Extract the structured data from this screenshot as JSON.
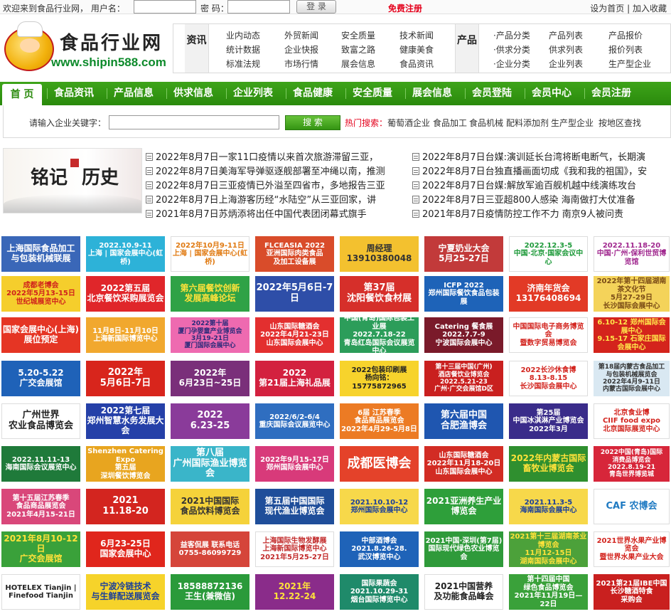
{
  "topbar": {
    "welcome": "欢迎来到食品行业网， 用户名：",
    "password_label": "密 码：",
    "login_button": "登 录",
    "register": "免费注册",
    "set_home": "设为首页",
    "divider": "|",
    "add_favorite": "加入收藏"
  },
  "logo": {
    "name": "食品行业网",
    "url": "www.shipin588.com"
  },
  "nav": {
    "cat1": "资讯",
    "cat2": "产品",
    "links1": [
      "业内动态",
      "外贸新闻",
      "安全质量",
      "技术新闻",
      "统计数据",
      "企业快报",
      "致富之路",
      "健康美食",
      "标准法规",
      "市场行情",
      "展会信息",
      "食品资讯"
    ],
    "links2": [
      "·产品分类",
      "产品列表",
      "产品报价",
      "·供求分类",
      "供求列表",
      "报价列表",
      "·企业分类",
      "企业列表",
      "生产型企业"
    ]
  },
  "menu": [
    "首 页",
    "食品资讯",
    "产品信息",
    "供求信息",
    "企业列表",
    "食品健康",
    "安全质量",
    "展会信息",
    "会员登陆",
    "会员中心",
    "会员注册"
  ],
  "search": {
    "label": "请输入企业关键字：",
    "button": "搜 索",
    "hot_label": "热门搜索：",
    "hot": [
      "葡萄酒企业",
      "食品加工",
      "食品机械",
      "配料添加剂",
      "生产型企业",
      "按地区查找"
    ]
  },
  "history": {
    "t1": "铭记",
    "t2": "历史"
  },
  "news_left": [
    "2022年8月7日一家11口疫情以来首次旅游滞留三亚，",
    "2022年8月7日美海军导弹驱逐舰部署至冲绳以南，推测",
    "2022年8月7日三亚疫情已外溢至四省市，多地报告三亚",
    "2022年8月7日上海游客历经“水陆空”从三亚回家，讲",
    "2021年8月7日苏炳添将出任中国代表团闭幕式旗手"
  ],
  "news_right": [
    "2022年8月7日台媒:演训延长台湾将断电断气，长期演",
    "2022年8月7日台独直播画面切成《我和我的祖国》，安",
    "2022年8月7日台媒:解放军逾百舰机越中线演练攻台",
    "2022年8月7日三亚超800人感染 海南做打大仗准备",
    "2021年8月7日疫情防控工作不力 南京9人被问责"
  ],
  "ads": [
    [
      {
        "text": "上海国际食品加工\n与包装机械联展",
        "bg": "#3a67b8",
        "fg": "#ffffff"
      },
      {
        "text": "2022.10.9-11\n上海 | 国家会展中心(虹桥)",
        "bg": "#2db2d8",
        "fg": "#ffffff"
      },
      {
        "text": "2022年10月9-11日\n上海 | 国家会展中心(虹桥)",
        "bg": "#ffffff",
        "fg": "#e07a12"
      },
      {
        "text": "FLCEASIA 2022\n亚洲国际肉类食品\n及加工设备展",
        "bg": "#d94c2a",
        "fg": "#ffffff"
      },
      {
        "text": "周经理\n13910380048",
        "bg": "#f3c12f",
        "fg": "#333333"
      },
      {
        "text": "宁夏奶业大会\n5月25-27日",
        "bg": "#c23a3a",
        "fg": "#ffffff"
      },
      {
        "text": "2022.12.3-5\n中国·北京·国家会议中心",
        "bg": "#ffffff",
        "fg": "#1e9a3a"
      },
      {
        "text": "2022.11.18-20\n中国·广州·保利世贸博览馆",
        "bg": "#ffffff",
        "fg": "#a0278e"
      }
    ],
    [
      {
        "text": "成都老博会\n2022年5月13-15日 世纪城展览中心",
        "bg": "#f5ce2c",
        "fg": "#d0221c"
      },
      {
        "text": "2022第五届\n北京餐饮采购展览会",
        "bg": "#e0262a",
        "fg": "#ffffff"
      },
      {
        "text": "第六届餐饮创新\n发展高峰论坛",
        "bg": "#2fa246",
        "fg": "#ffe23a"
      },
      {
        "text": "2022年5月6日-7日",
        "bg": "#2e4ea8",
        "fg": "#ffffff"
      },
      {
        "text": "第37届\n沈阳餐饮食材展",
        "bg": "#d62f2a",
        "fg": "#ffffff"
      },
      {
        "text": "ICFP 2022\n郑州国际餐饮食品包装展",
        "bg": "#1e63b8",
        "fg": "#ffffff"
      },
      {
        "text": "济南年货会\n13176408694",
        "bg": "#e23a26",
        "fg": "#ffffff"
      },
      {
        "text": "2022年第十四届湖南茶文化节\n5月27-29日\n长沙国际会展中心",
        "bg": "#f4d35a",
        "fg": "#7a4b16"
      }
    ],
    [
      {
        "text": "国家会展中心(上海)\n展位预定",
        "bg": "#e53524",
        "fg": "#ffffff"
      },
      {
        "text": "11月8日-11月10日\n上海新国际博览中心",
        "bg": "#f1a82e",
        "fg": "#ffffff"
      },
      {
        "text": "2022第十届\n厦门孕婴童产业博览会\n3月19-21日\n厦门国际会展中心",
        "bg": "#ee6ab0",
        "fg": "#2a2a7a"
      },
      {
        "text": "山东国际糖酒会\n2022年4月21-23日\n山东国际会展中心",
        "bg": "#e32f2f",
        "fg": "#ffffff"
      },
      {
        "text": "中国(青岛)国际包装工业展\n2022.7.18-22\n青岛红岛国际会议展览中心",
        "bg": "#2c9d5a",
        "fg": "#ffffff"
      },
      {
        "text": "Catering 餐食展\n2022.7.7-9\n宁波国际会展中心",
        "bg": "#7a1a2a",
        "fg": "#ffffff"
      },
      {
        "text": "中国国际电子商务博览会\n暨数字贸易博览会",
        "bg": "#ffffff",
        "fg": "#d3251f"
      },
      {
        "text": "6.10-12 郑州国际会展中心\n9.15-17 石家庄国际会展中心",
        "bg": "#d4241c",
        "fg": "#ffe54a"
      }
    ],
    [
      {
        "text": "5.20-5.22\n广交会展馆",
        "bg": "#1f62b8",
        "fg": "#ffffff"
      },
      {
        "text": "2022年\n5月6日-7日",
        "bg": "#d8251c",
        "fg": "#ffffff"
      },
      {
        "text": "2022年\n6月23日~25日",
        "bg": "#7a2f7a",
        "fg": "#ffffff"
      },
      {
        "text": "2022\n第21届上海礼品展",
        "bg": "#d3213f",
        "fg": "#ffffff"
      },
      {
        "text": "2022包装印刷展\n杨向铭：15775872965",
        "bg": "#f7d32c",
        "fg": "#222222"
      },
      {
        "text": "第十三届中国(广州)\n酒店餐饮业博览会\n2022.5.21-23\n广州·广交会展馆D区",
        "bg": "#c9201f",
        "fg": "#ffffff"
      },
      {
        "text": "2022长沙休食博\n8.13-8.15\n长沙国际会展中心",
        "bg": "#ffffff",
        "fg": "#d3251f"
      },
      {
        "text": "第18届内蒙古食品加工\n与包装机械展览会\n2022年4月9-11日\n内蒙古国际会展中心",
        "bg": "#d9e8f2",
        "fg": "#333333"
      }
    ],
    [
      {
        "text": "广州世界\n农业食品博览会",
        "bg": "#ffffff",
        "fg": "#222222"
      },
      {
        "text": "2022第七届\n郑州智慧水务发展大会",
        "bg": "#2540a8",
        "fg": "#ffffff"
      },
      {
        "text": "2022\n6.23-25",
        "bg": "#8a3b9a",
        "fg": "#ffffff"
      },
      {
        "text": "2022/6/2-6/4\n重庆国际会议展览中心",
        "bg": "#2f6ec0",
        "fg": "#ffffff"
      },
      {
        "text": "6届 江苏春季\n食品商品展览会\n2022年4月29-5月8日",
        "bg": "#ec7b24",
        "fg": "#ffffff"
      },
      {
        "text": "第六届中国\n合肥渔博会",
        "bg": "#1f56b0",
        "fg": "#ffffff"
      },
      {
        "text": "第25届\n中国冰淇淋产业博览会\n2022年3月",
        "bg": "#3a2c8a",
        "fg": "#ffffff"
      },
      {
        "text": "北京食业博\nCIIF food expo\n北京国际展览中心",
        "bg": "#ffffff",
        "fg": "#d3251f"
      }
    ],
    [
      {
        "text": "2022.11.11-13\n海南国际会议展览中心",
        "bg": "#1f7a3a",
        "fg": "#ffffff"
      },
      {
        "text": "Shenzhen Catering Expo\n第五届\n深圳餐饮博览会",
        "bg": "#e8a51f",
        "fg": "#ffffff"
      },
      {
        "text": "第八届\n广州国际渔业博览会",
        "bg": "#3ab5c9",
        "fg": "#ffffff"
      },
      {
        "text": "2022年9月15-17日\n郑州国际会展中心",
        "bg": "#d83a7a",
        "fg": "#ffffff"
      },
      {
        "text": "成都医博会",
        "bg": "#e4422a",
        "fg": "#ffffff"
      },
      {
        "text": "山东国际糖酒会\n2022年11月18-20日\n山东国际会展中心",
        "bg": "#d22c24",
        "fg": "#ffffff"
      },
      {
        "text": "2022年内蒙古国际\n畜牧业博览会",
        "bg": "#2f8f2f",
        "fg": "#ffe23a"
      },
      {
        "text": "2022中国(青岛)国际\n消费品博览会\n2022.8.19-21\n青岛世界博览城",
        "bg": "#d7263a",
        "fg": "#ffffff"
      }
    ],
    [
      {
        "text": "第十五届江苏春季\n食品商品展览会\n2021年4月15-21日",
        "bg": "#d9477a",
        "fg": "#ffffff"
      },
      {
        "text": "2021\n11.18-20",
        "bg": "#d3251f",
        "fg": "#ffffff"
      },
      {
        "text": "2021中国国际\n食品饮料博览会",
        "bg": "#f5d23a",
        "fg": "#333333"
      },
      {
        "text": "第五届中国国际\n现代渔业博览会",
        "bg": "#1f4e9a",
        "fg": "#ffffff"
      },
      {
        "text": "2021.10.10-12\n郑州国际会展中心",
        "bg": "#f7d84a",
        "fg": "#1a3f9a"
      },
      {
        "text": "2021亚洲养生产业博览会",
        "bg": "#2e9f3a",
        "fg": "#ffffff"
      },
      {
        "text": "2021.11.3-5\n海南国际会展中心",
        "bg": "#f7d84a",
        "fg": "#1a3f9a"
      },
      {
        "text": "CAF 农博会",
        "bg": "#ffffff",
        "fg": "#1f7ac2"
      }
    ],
    [
      {
        "text": "2021年8月10-12日\n广交会展馆",
        "bg": "#3aa13a",
        "fg": "#ffe23a"
      },
      {
        "text": "6月23-25日\n国家会展中心",
        "bg": "#e0261c",
        "fg": "#ffffff"
      },
      {
        "text": "益客侃展 联系电话\n0755-86099729",
        "bg": "#d5453a",
        "fg": "#ffffff"
      },
      {
        "text": "上海国际生物发酵展\n上海新国际博览中心\n2021年5月25-27日",
        "bg": "#ffffff",
        "fg": "#c22a2a"
      },
      {
        "text": "中部酒博会\n2021.8.26-28.\n武汉博览中心",
        "bg": "#1f63b8",
        "fg": "#ffffff"
      },
      {
        "text": "2021中国·深圳(第7届)\n国际现代绿色农业博览会",
        "bg": "#2f9a3a",
        "fg": "#ffffff"
      },
      {
        "text": "2021第十三届湖南茶业博览会\n11月12-15日\n湖南国际会展中心",
        "bg": "#4ca13a",
        "fg": "#ffe23a"
      },
      {
        "text": "2021世界水果产业博览会\n暨世界水果产业大会",
        "bg": "#ffffff",
        "fg": "#d3251f"
      }
    ],
    [
      {
        "text": "HOTELEX Tianjin | Finefood Tianjin",
        "bg": "#ffffff",
        "fg": "#222222"
      },
      {
        "text": "宁波冷链技术\n与生鲜配送展览会",
        "bg": "#f6d32a",
        "fg": "#1a3f9a"
      },
      {
        "text": "18588872136\n王生(兼微信)",
        "bg": "#2a9a3a",
        "fg": "#ffffff"
      },
      {
        "text": "2021年\n12.22-24",
        "bg": "#8a2c8a",
        "fg": "#ffe23a"
      },
      {
        "text": "国际果蔬会\n2021.10.29-31\n烟台国际博览中心",
        "bg": "#1f8a6a",
        "fg": "#ffffff"
      },
      {
        "text": "2021中国营养\n及功能食品峰会",
        "bg": "#ffffff",
        "fg": "#222222"
      },
      {
        "text": "第十四届中国\n绿色食品博览会\n2021年11月19日—22日",
        "bg": "#3aa13a",
        "fg": "#ffffff"
      },
      {
        "text": "2021第21届IBE中国\n长沙糖酒特食\n采购会",
        "bg": "#c9201f",
        "fg": "#ffffff"
      }
    ]
  ]
}
